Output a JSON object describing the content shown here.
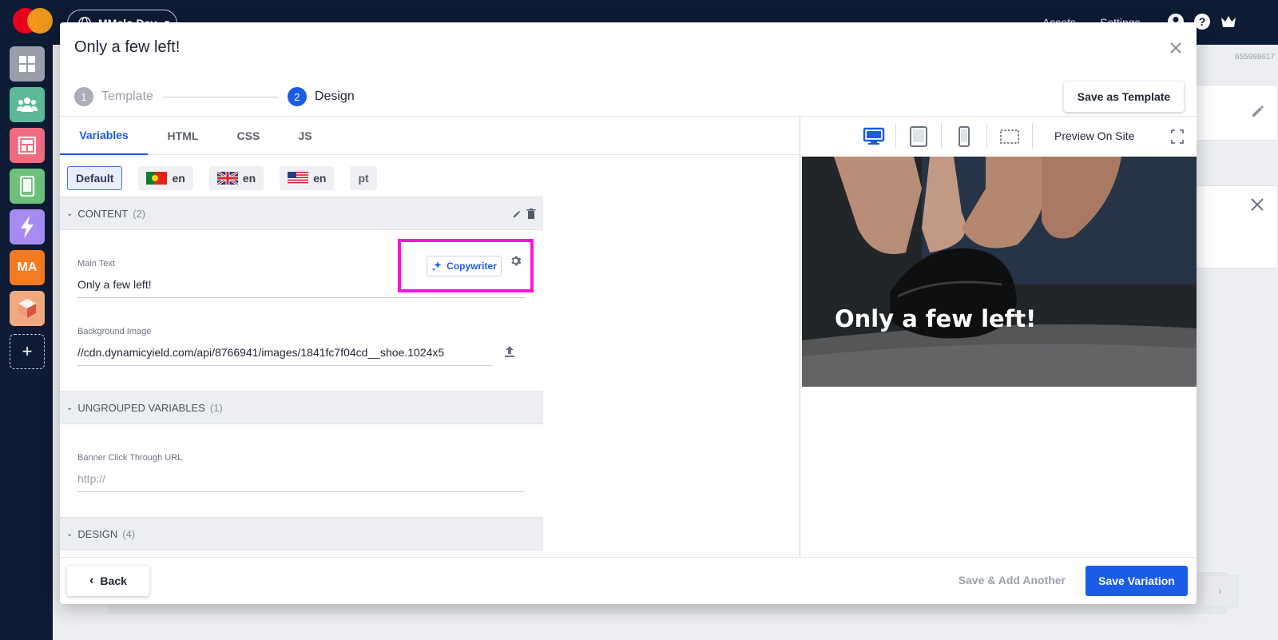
{
  "topbar": {
    "site_name": "MMelo Dev",
    "assets": "Assets",
    "settings": "Settings"
  },
  "rail": {
    "items": [
      {
        "icon": "grid-icon",
        "color": "#9aa0ab"
      },
      {
        "icon": "audiences-icon",
        "color": "#5cb899"
      },
      {
        "icon": "layout-icon",
        "color": "#ef6b7f"
      },
      {
        "icon": "mobile-icon",
        "color": "#6bc07a"
      },
      {
        "icon": "bolt-icon",
        "color": "#a78bf2"
      },
      {
        "icon": "ma-badge",
        "label": "MA",
        "color": "#f47b1f"
      },
      {
        "icon": "box-icon",
        "color": "#f1a87e"
      }
    ],
    "add_label": "+"
  },
  "background": {
    "id_fragment": "655998617"
  },
  "modal": {
    "title": "Only a few left!",
    "steps": [
      {
        "num": "1",
        "label": "Template"
      },
      {
        "num": "2",
        "label": "Design"
      }
    ],
    "save_template": "Save as Template",
    "tabs": [
      "Variables",
      "HTML",
      "CSS",
      "JS"
    ],
    "languages": [
      {
        "label": "Default"
      },
      {
        "label": "en",
        "flag": "portugal-flag"
      },
      {
        "label": "en",
        "flag": "uk-flag"
      },
      {
        "label": "en",
        "flag": "us-flag"
      },
      {
        "label": "pt"
      }
    ],
    "groups": {
      "content": {
        "name": "CONTENT",
        "count": "(2)"
      },
      "ungrouped": {
        "name": "UNGROUPED VARIABLES",
        "count": "(1)"
      },
      "design": {
        "name": "DESIGN",
        "count": "(4)"
      }
    },
    "fields": {
      "main_text_label": "Main Text",
      "main_text_value": "Only a few left!",
      "bg_image_label": "Background Image",
      "bg_image_value": "//cdn.dynamicyield.com/api/8766941/images/1841fc7f04cd__shoe.1024x5",
      "click_url_label": "Banner Click Through URL",
      "click_url_placeholder": "http://"
    },
    "copywriter": "Copywriter",
    "preview": {
      "on_site": "Preview On Site",
      "banner_text": "Only a few left!"
    },
    "footer": {
      "back": "Back",
      "save_add": "Save & Add Another",
      "save_variation": "Save Variation"
    }
  }
}
